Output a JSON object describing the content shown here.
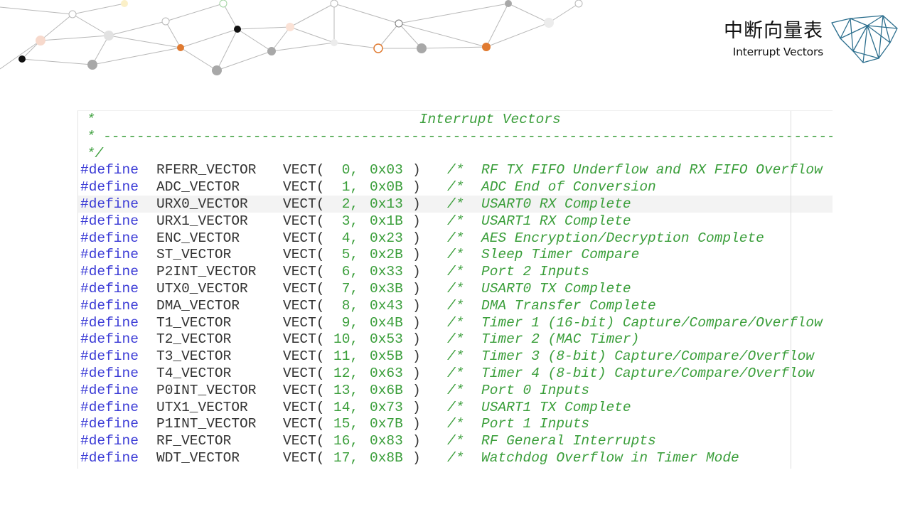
{
  "header": {
    "title_zh": "中断向量表",
    "title_en": "Interrupt Vectors"
  },
  "code": {
    "header_lines": [
      {
        "text": " *                                       Interrupt Vectors"
      },
      {
        "text": " * ------------------------------------------------------------------------------------------------"
      },
      {
        "text": " */"
      }
    ],
    "define_keyword": "#define",
    "vect_keyword": "VECT(",
    "rows": [
      {
        "name": "RFERR_VECTOR",
        "num": " 0,",
        "addr": "0x03",
        "comment": "RF TX FIFO Underflow and RX FIFO Overflow"
      },
      {
        "name": "ADC_VECTOR",
        "num": " 1,",
        "addr": "0x0B",
        "comment": "ADC End of Conversion"
      },
      {
        "name": "URX0_VECTOR",
        "num": " 2,",
        "addr": "0x13",
        "comment": "USART0 RX Complete"
      },
      {
        "name": "URX1_VECTOR",
        "num": " 3,",
        "addr": "0x1B",
        "comment": "USART1 RX Complete"
      },
      {
        "name": "ENC_VECTOR",
        "num": " 4,",
        "addr": "0x23",
        "comment": "AES Encryption/Decryption Complete"
      },
      {
        "name": "ST_VECTOR",
        "num": " 5,",
        "addr": "0x2B",
        "comment": "Sleep Timer Compare"
      },
      {
        "name": "P2INT_VECTOR",
        "num": " 6,",
        "addr": "0x33",
        "comment": "Port 2 Inputs"
      },
      {
        "name": "UTX0_VECTOR",
        "num": " 7,",
        "addr": "0x3B",
        "comment": "USART0 TX Complete"
      },
      {
        "name": "DMA_VECTOR",
        "num": " 8,",
        "addr": "0x43",
        "comment": "DMA Transfer Complete"
      },
      {
        "name": "T1_VECTOR",
        "num": " 9,",
        "addr": "0x4B",
        "comment": "Timer 1 (16-bit) Capture/Compare/Overflow"
      },
      {
        "name": "T2_VECTOR",
        "num": "10,",
        "addr": "0x53",
        "comment": "Timer 2 (MAC Timer)"
      },
      {
        "name": "T3_VECTOR",
        "num": "11,",
        "addr": "0x5B",
        "comment": "Timer 3 (8-bit) Capture/Compare/Overflow"
      },
      {
        "name": "T4_VECTOR",
        "num": "12,",
        "addr": "0x63",
        "comment": "Timer 4 (8-bit) Capture/Compare/Overflow"
      },
      {
        "name": "P0INT_VECTOR",
        "num": "13,",
        "addr": "0x6B",
        "comment": "Port 0 Inputs"
      },
      {
        "name": "UTX1_VECTOR",
        "num": "14,",
        "addr": "0x73",
        "comment": "USART1 TX Complete"
      },
      {
        "name": "P1INT_VECTOR",
        "num": "15,",
        "addr": "0x7B",
        "comment": "Port 1 Inputs"
      },
      {
        "name": "RF_VECTOR",
        "num": "16,",
        "addr": "0x83",
        "comment": "RF General Interrupts"
      },
      {
        "name": "WDT_VECTOR",
        "num": "17,",
        "addr": "0x8B",
        "comment": "Watchdog Overflow in Timer Mode"
      }
    ],
    "highlighted_row": 2
  },
  "colors": {
    "keyword": "#3b3bd6",
    "comment": "#3a9e3a",
    "identifier": "#333333",
    "node_orange": "#e07a30",
    "logo_stroke": "#2d6f8e"
  }
}
